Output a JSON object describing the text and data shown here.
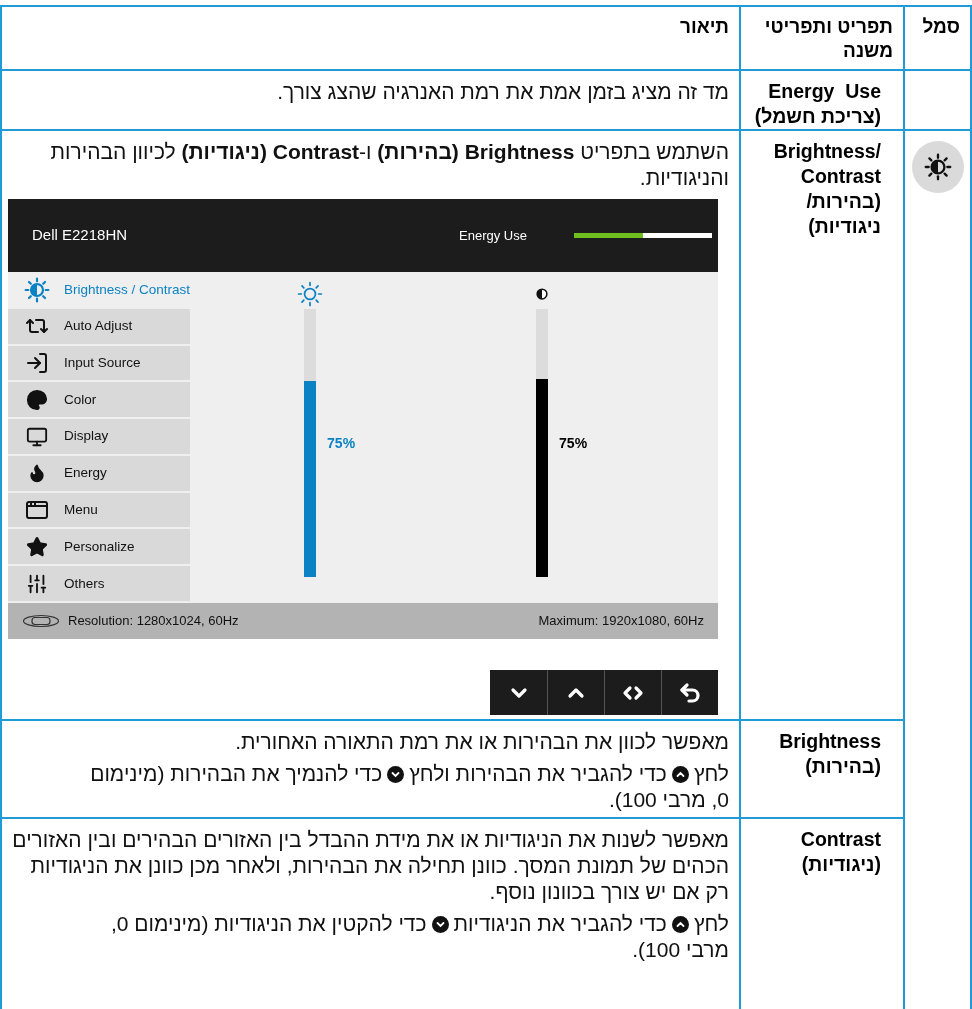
{
  "table": {
    "columns": [
      "סמל",
      "תפריט ותפריטי משנה",
      "תיאור"
    ],
    "rows": [
      {
        "name": "Energy  Use",
        "name_sub": "(צריכת חשמל)",
        "paragraphs": [
          [
            {
              "kind": "text",
              "text": "מד זה מציג בזמן אמת את רמת האנרגיה שהצג צורך."
            }
          ]
        ]
      },
      {
        "name": "Brightness/ Contrast",
        "name_sub": "(בהירות/ ניגודיות)",
        "has_symbol": true,
        "paragraphs": [
          [
            {
              "kind": "text",
              "text": "השתמש בתפריט **Brightness (בהירות)** ו-**Contrast (ניגודיות)** לכיוון הבהירות והניגודיות."
            }
          ]
        ],
        "osd": {
          "model": "Dell E2218HN",
          "energy_label": "Energy Use",
          "energy": {
            "level": 0.5
          },
          "menu": [
            {
              "label": "Brightness / Contrast",
              "selected": true
            },
            {
              "label": "Auto Adjust",
              "selected": false
            },
            {
              "label": "Input Source",
              "selected": false
            },
            {
              "label": "Color",
              "selected": false
            },
            {
              "label": "Display",
              "selected": false
            },
            {
              "label": "Energy",
              "selected": false
            },
            {
              "label": "Menu",
              "selected": false
            },
            {
              "label": "Personalize",
              "selected": false
            },
            {
              "label": "Others",
              "selected": false
            }
          ],
          "brightness_slider": {
            "kind": "brightness",
            "level": 0.73,
            "reading": "75%"
          },
          "contrast_slider": {
            "kind": "contrast",
            "level": 0.74,
            "reading": "75%"
          },
          "resolution": "Resolution: 1280x1024, 60Hz",
          "maximum": "Maximum: 1920x1080, 60Hz",
          "buttons": [
            {
              "kind": "down"
            },
            {
              "kind": "up"
            },
            {
              "kind": "toggle"
            },
            {
              "kind": "back"
            }
          ]
        }
      },
      {
        "name": "Brightness",
        "name_sub": "(בהירות)",
        "paragraphs": [
          [
            {
              "kind": "text",
              "text": "מאפשר לכוון את הבהירות או את רמת התאורה האחורית."
            }
          ],
          [
            {
              "kind": "text",
              "text": "לחץ"
            },
            {
              "kind": "up"
            },
            {
              "kind": "text",
              "text": "כדי להגביר את הבהירות ולחץ"
            },
            {
              "kind": "down"
            },
            {
              "kind": "text",
              "text": "כדי להנמיך את הבהירות (מינימום"
            },
            {
              "kind": "break"
            },
            {
              "kind": "text",
              "text": "0, מרבי 100)."
            }
          ]
        ]
      },
      {
        "name": "Contrast",
        "name_sub": "(ניגודיות)",
        "paragraphs": [
          [
            {
              "kind": "text",
              "text": "מאפשר לשנות את הניגודיות או את מידת ההבדל בין האזורים הבהירים ובין האזורים הכהים של תמונת המסך. כוונן תחילה את הבהירות, ולאחר מכן כוונן את הניגודיות רק אם יש צורך בכוונון נוסף."
            }
          ],
          [
            {
              "kind": "text",
              "text": "לחץ"
            },
            {
              "kind": "up"
            },
            {
              "kind": "text",
              "text": "כדי להגביר את הניגודיות"
            },
            {
              "kind": "down"
            },
            {
              "kind": "text",
              "text": "כדי להקטין את הניגודיות (מינימום 0,"
            },
            {
              "kind": "break"
            },
            {
              "kind": "text",
              "text": "מרבי 100)."
            }
          ]
        ]
      }
    ]
  }
}
